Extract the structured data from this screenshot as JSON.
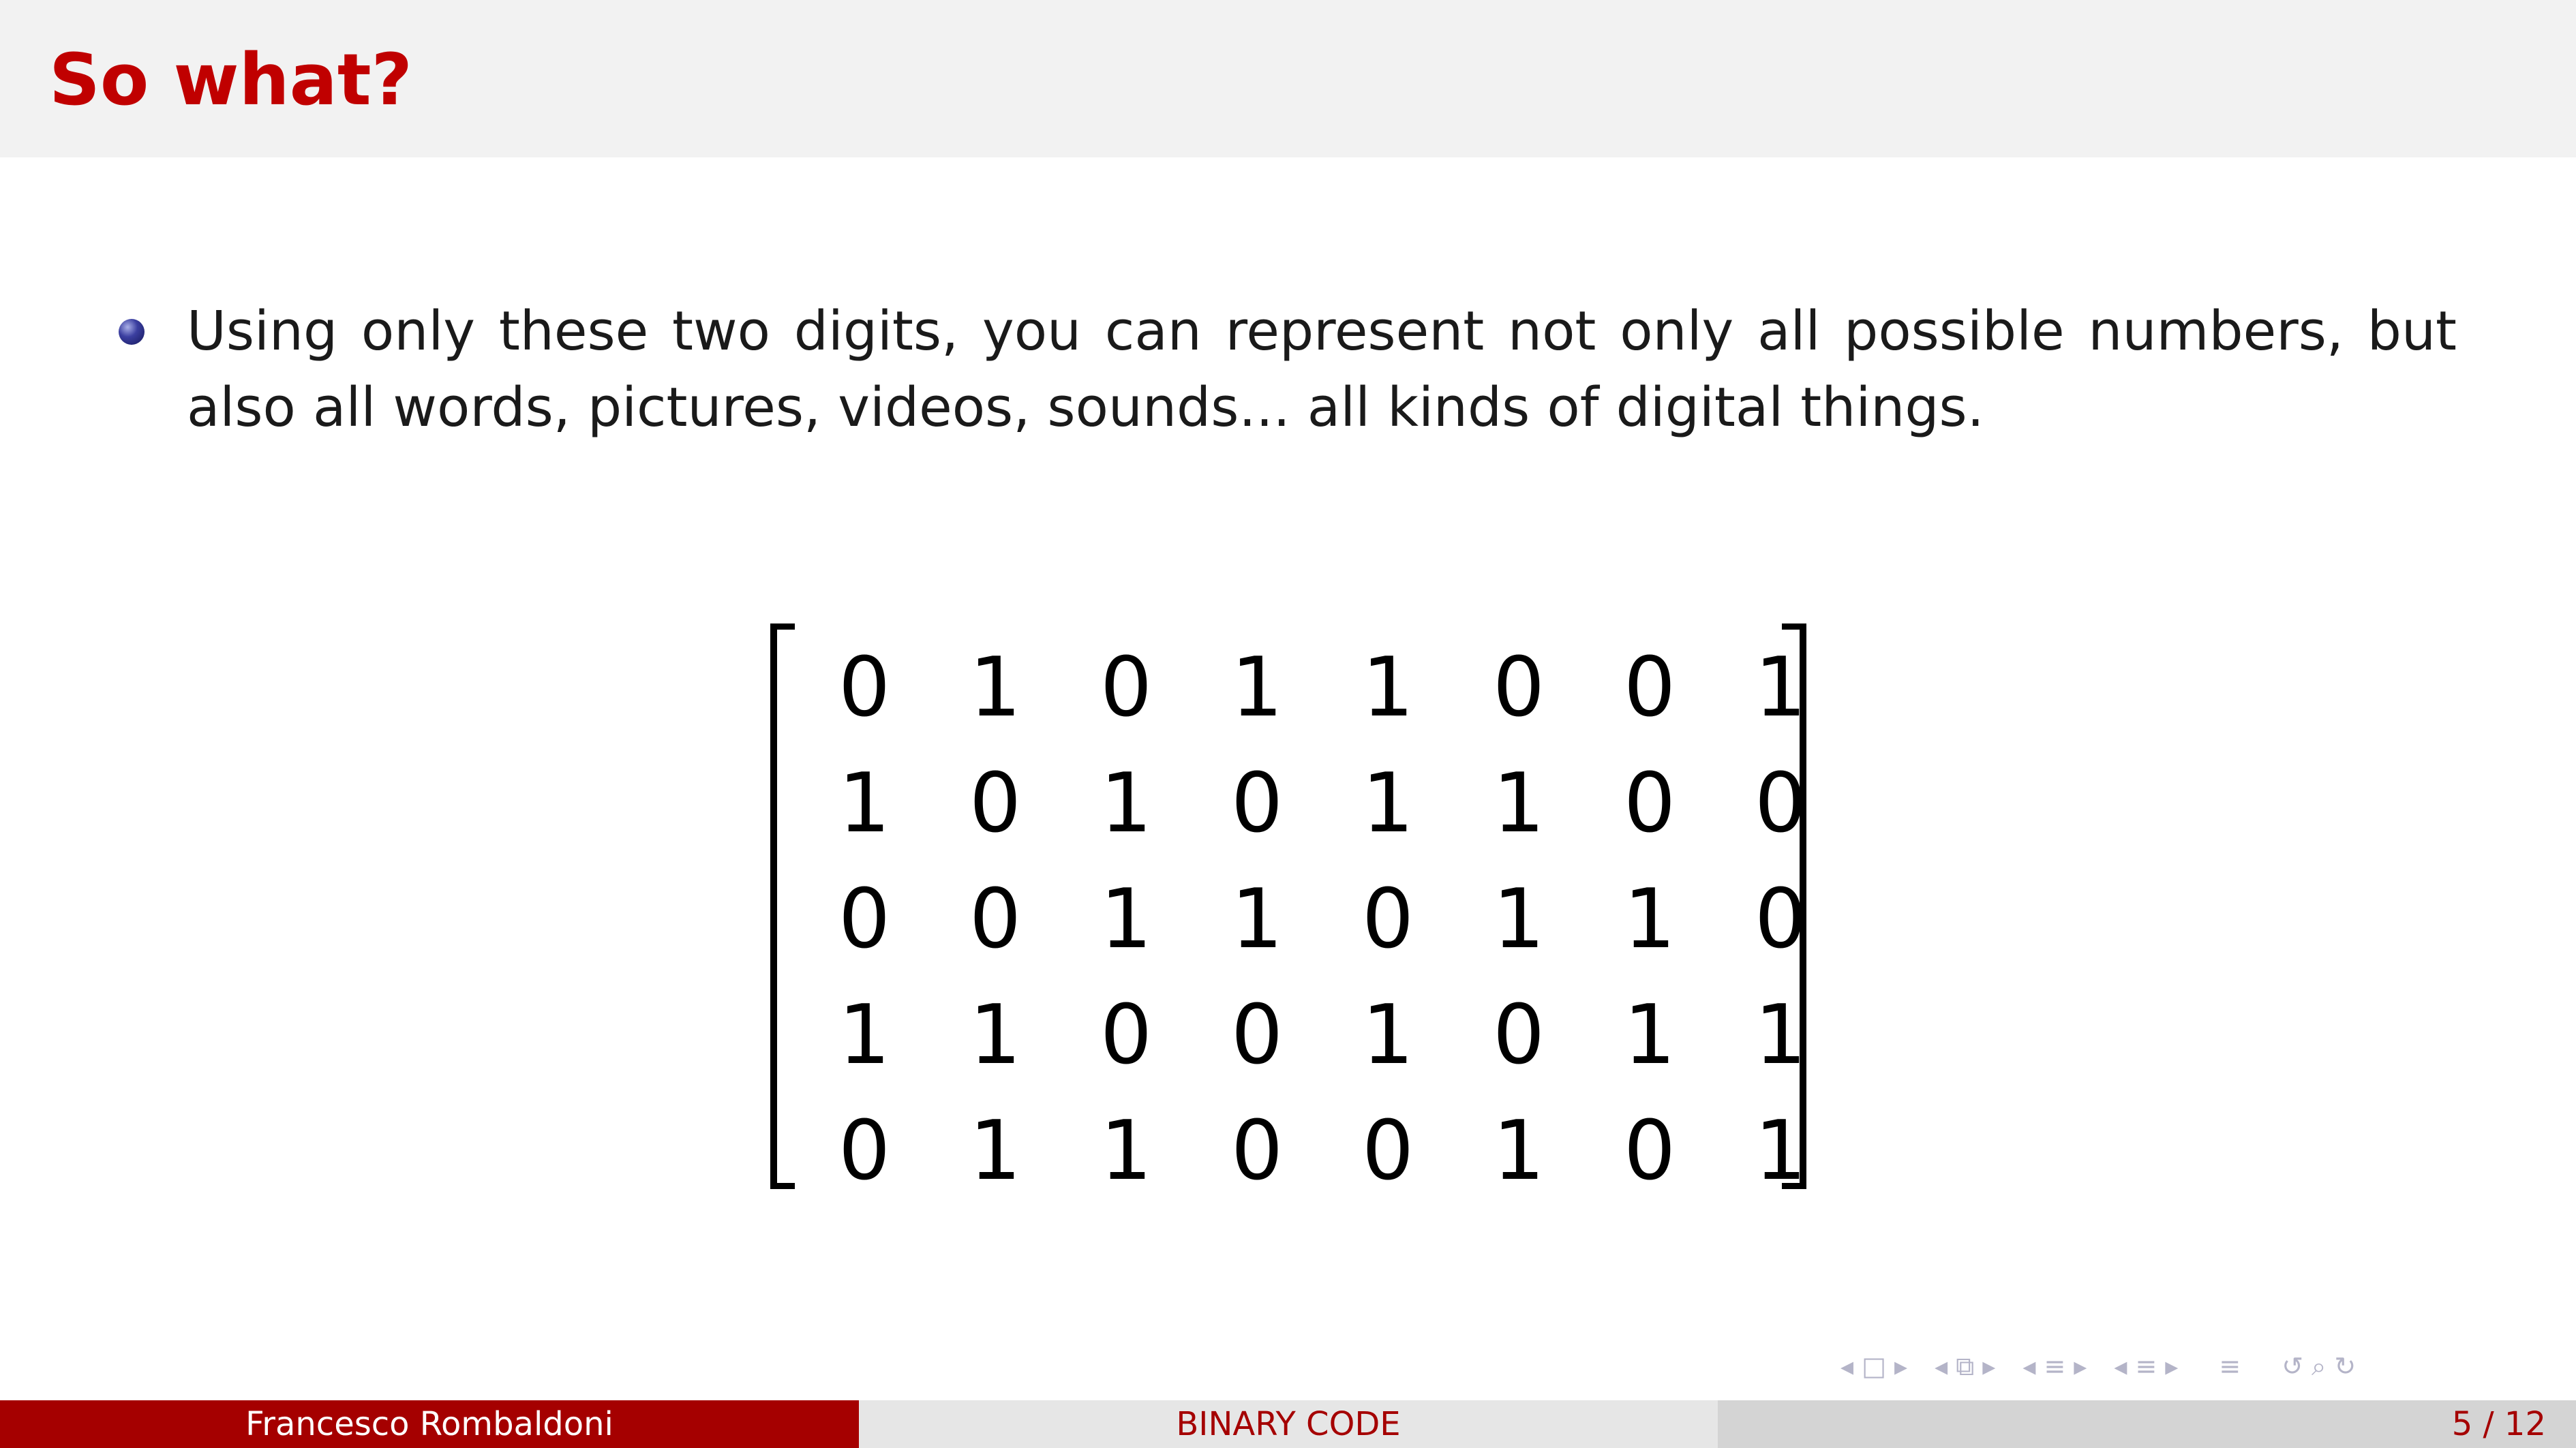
{
  "slide": {
    "title": "So what?",
    "bullet": "Using only these two digits, you can represent not only all possible numbers, but also all words, pictures, videos, sounds... all kinds of digital things.",
    "matrix": [
      [
        "0",
        "1",
        "0",
        "1",
        "1",
        "0",
        "0",
        "1"
      ],
      [
        "1",
        "0",
        "1",
        "0",
        "1",
        "1",
        "0",
        "0"
      ],
      [
        "0",
        "0",
        "1",
        "1",
        "0",
        "1",
        "1",
        "0"
      ],
      [
        "1",
        "1",
        "0",
        "0",
        "1",
        "0",
        "1",
        "1"
      ],
      [
        "0",
        "1",
        "1",
        "0",
        "0",
        "1",
        "0",
        "1"
      ]
    ]
  },
  "navigation": {
    "icons": [
      "◂",
      "□",
      "▸",
      "◂",
      "⧉",
      "▸",
      "◂",
      "≡",
      "▸",
      "◂",
      "≡",
      "▸",
      "≡",
      "↺",
      "⌕",
      "↻"
    ]
  },
  "footer": {
    "author": "Francesco Rombaldoni",
    "title": "BINARY CODE",
    "page": "5 / 12"
  },
  "colors": {
    "title": "#c00000",
    "footer_left_bg": "#a50000",
    "title_bar_bg": "#f2f2f2",
    "bullet": "#3b3fa0"
  }
}
